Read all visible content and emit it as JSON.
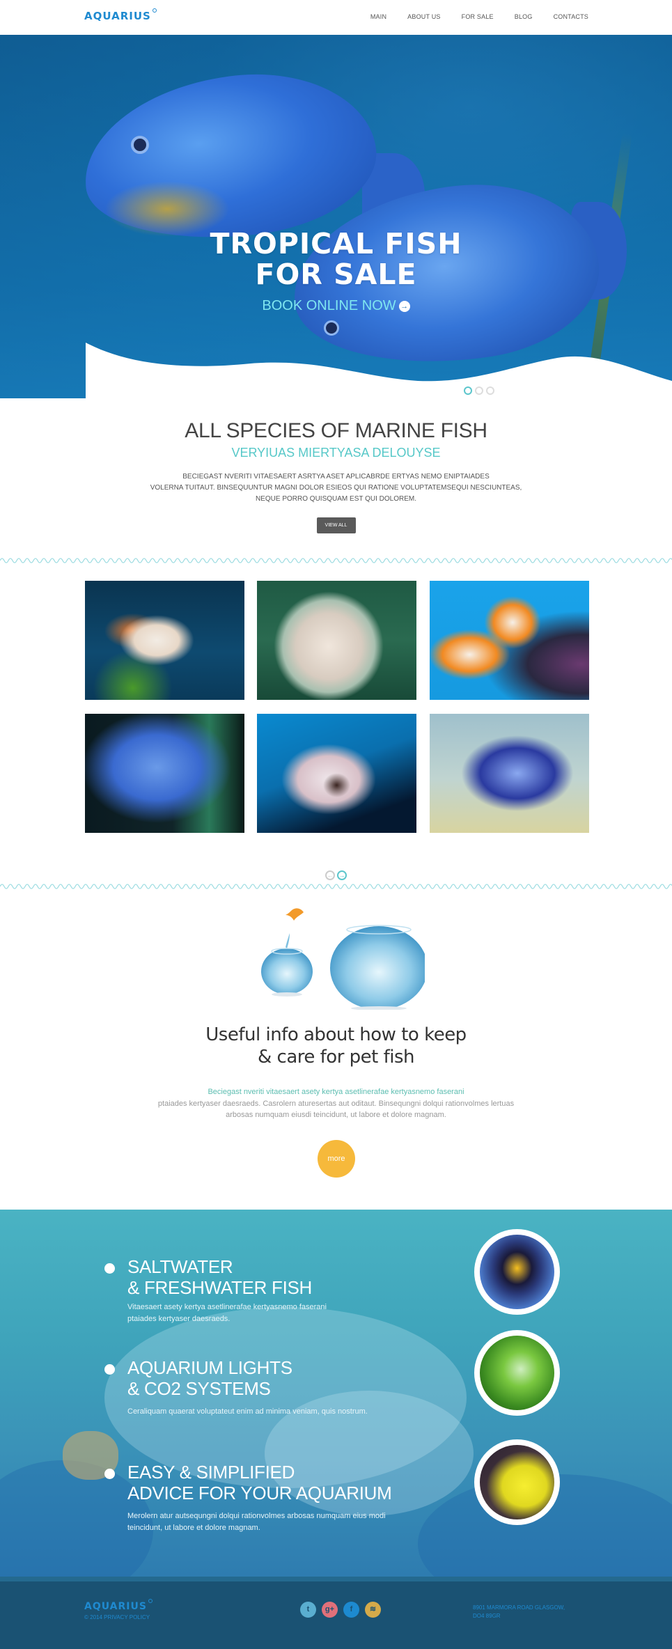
{
  "header": {
    "logo": "AQUARIUS",
    "nav": [
      {
        "label": "MAIN"
      },
      {
        "label": "ABOUT US"
      },
      {
        "label": "FOR SALE"
      },
      {
        "label": "BLOG"
      },
      {
        "label": "CONTACTS"
      }
    ]
  },
  "hero": {
    "title_line1": "TROPICAL FISH",
    "title_line2": "FOR SALE",
    "cta": "BOOK ONLINE NOW",
    "cta_icon": "arrow-right-circle-icon",
    "slides": 3,
    "active_slide": 1
  },
  "species": {
    "title": "ALL SPECIES OF MARINE FISH",
    "subtitle": "VERYIUAS MIERTYASA DELOUYSE",
    "text_lines": [
      "BECIEGAST NVERITI VITAESAERT ASRTYA ASET APLICABRDE ERTYAS NEMO ENIPTAIADES",
      "VOLERNA TUITAUT. BINSEQUUNTUR MAGNI DOLOR ESIEOS QUI RATIONE VOLUPTATEMSEQUI NESCIUNTEAS,",
      "NEQUE PORRO QUISQUAM EST QUI DOLOREM."
    ],
    "button": "VIEW ALL"
  },
  "gallery": {
    "images": [
      {
        "name": "angelfish",
        "colors": [
          "#0b3d5c",
          "#f07a2a",
          "#e8e2d8"
        ]
      },
      {
        "name": "pufferfish",
        "colors": [
          "#1f5a44",
          "#e8dcd0",
          "#2a2a2a"
        ]
      },
      {
        "name": "butterflyfish",
        "colors": [
          "#1aa3ea",
          "#f28a22",
          "#f0f0f0"
        ]
      },
      {
        "name": "blue-cichlid",
        "colors": [
          "#0a1a20",
          "#3a7ad8",
          "#2f8f6a"
        ]
      },
      {
        "name": "triggerfish",
        "colors": [
          "#0a6fae",
          "#d8c0c8",
          "#3a2420"
        ]
      },
      {
        "name": "clown-triggerfish",
        "colors": [
          "#b8d2d8",
          "#2a3aa0",
          "#f0f0e8"
        ]
      }
    ],
    "prev_icon": "arrow-left-circle-icon",
    "next_icon": "arrow-right-circle-icon"
  },
  "info": {
    "title_line1": "Useful info about how to keep",
    "title_line2": "& care for pet fish",
    "lead": "Beciegast nveriti vitaesaert asety kertya asetlinerafae kertyasnemo faserani",
    "body_lines": [
      "ptaiades kertyaser daesraeds. Casrolern aturesertas aut oditaut. Binsequngni dolqui rationvolmes lertuas",
      "arbosas numquam eiusdi teincidunt, ut labore et dolore magnam."
    ],
    "button": "more"
  },
  "features": [
    {
      "title": "SALTWATER\n& FRESHWATER FISH",
      "desc": "Vitaesaert asety kertya asetlinerafae kertyasnemo faserani\nptaiades kertyaser daesraeds.",
      "image": "clownfish"
    },
    {
      "title": "AQUARIUM LIGHTS\n& CO2 SYSTEMS",
      "desc": "Ceraliquam quaerat voluptateut enim ad minima veniam, quis nostrum.",
      "image": "co2-diffuser"
    },
    {
      "title": "EASY & SIMPLIFIED\nADVICE FOR YOUR AQUARIUM",
      "desc": "Merolern atur autsequngni dolqui rationvolmes arbosas numquam eius modi\nteincidunt, ut labore et dolore magnam.",
      "image": "yellow-tang"
    }
  ],
  "footer": {
    "logo": "AQUARIUS",
    "copyright": "© 2014 PRIVACY POLICY",
    "socials": [
      {
        "name": "twitter",
        "glyph": "t",
        "color": "#5aaed0"
      },
      {
        "name": "google-plus",
        "glyph": "g+",
        "color": "#e0707a"
      },
      {
        "name": "facebook",
        "glyph": "f",
        "color": "#1d8ad0"
      },
      {
        "name": "rss",
        "glyph": "≋",
        "color": "#d4aa4a"
      }
    ],
    "address": "8901 MARMORA ROAD GLASGOW,\nDO4 89GR"
  },
  "colors": {
    "brand": "#1f8ad0",
    "accent_teal": "#56c8c8",
    "more_button": "#f6b93b",
    "footer_bg": "#1a5273",
    "view_all_button": "#5a5a5a"
  }
}
